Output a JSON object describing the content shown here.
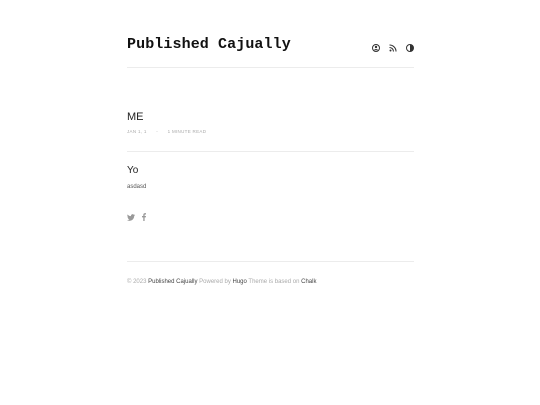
{
  "header": {
    "site_title": "Published Cajually",
    "icons": [
      "about-icon",
      "rss-icon",
      "theme-toggle-icon"
    ]
  },
  "post": {
    "title": "ME",
    "date": "JAN 1, 1",
    "separator": "-",
    "read_time": "1 MINUTE READ",
    "heading": "Yo",
    "body": "asdasd"
  },
  "share": {
    "icons": [
      "twitter-icon",
      "facebook-icon"
    ]
  },
  "footer": {
    "copyright": "© 2023",
    "site_link": "Published Cajually",
    "powered_text": "Powered by",
    "hugo_link": "Hugo",
    "theme_text": "Theme is based on",
    "chalk_link": "Chalk"
  },
  "colors": {
    "text": "#333333",
    "muted": "#aaaaaa",
    "divider": "#ececec"
  }
}
